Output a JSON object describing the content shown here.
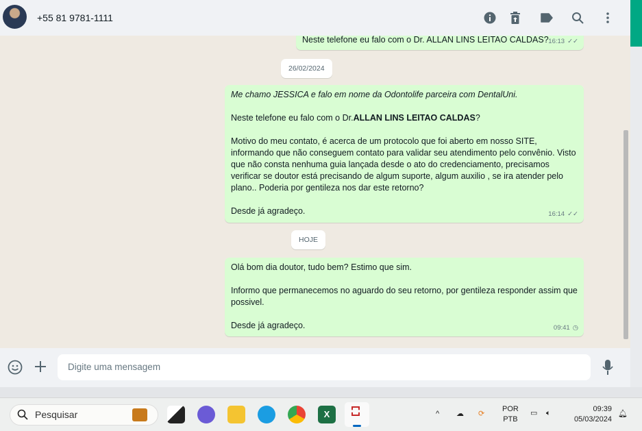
{
  "header": {
    "contact": "+55 81 9781-1111",
    "icons": [
      "info-icon",
      "trash-icon",
      "label-icon",
      "search-icon",
      "menu-icon"
    ]
  },
  "messages": [
    {
      "text": "Neste telefone eu falo com o Dr. ALLAN LINS LEITAO CALDAS?",
      "time": "16:13",
      "status": "read"
    },
    {
      "date": "26/02/2024"
    },
    {
      "intro": "Me chamo JESSICA e falo em nome da Odontolife parceira com DentalUni.",
      "line2_prefix": "Neste telefone eu falo com o Dr.",
      "line2_bold": "ALLAN LINS LEITAO CALDAS",
      "line2_suffix": "?",
      "body": "Motivo do meu contato, é acerca de um protocolo que foi aberto em nosso SITE, informando que não conseguem contato para validar seu atendimento pelo convênio. Visto que não consta nenhuma guia lançada desde o ato do credenciamento, precisamos verificar se doutor está precisando de algum suporte, algum auxilio , se ira atender pelo plano.. Poderia por gentileza nos dar este retorno?",
      "closing": "Desde já agradeço.",
      "time": "16:14",
      "status": "read"
    },
    {
      "date": "HOJE"
    },
    {
      "line1": "Olá bom dia doutor, tudo bem? Estimo que sim.",
      "line2": "Informo que permanecemos no aguardo do seu retorno, por gentileza responder assim que possivel.",
      "closing": "Desde já agradeço.",
      "time": "09:41",
      "status": "pending"
    }
  ],
  "composer": {
    "placeholder": "Digite uma mensagem"
  },
  "taskbar": {
    "search": "Pesquisar",
    "lang1": "POR",
    "lang2": "PTB",
    "time": "09:39",
    "date": "05/03/2024"
  }
}
